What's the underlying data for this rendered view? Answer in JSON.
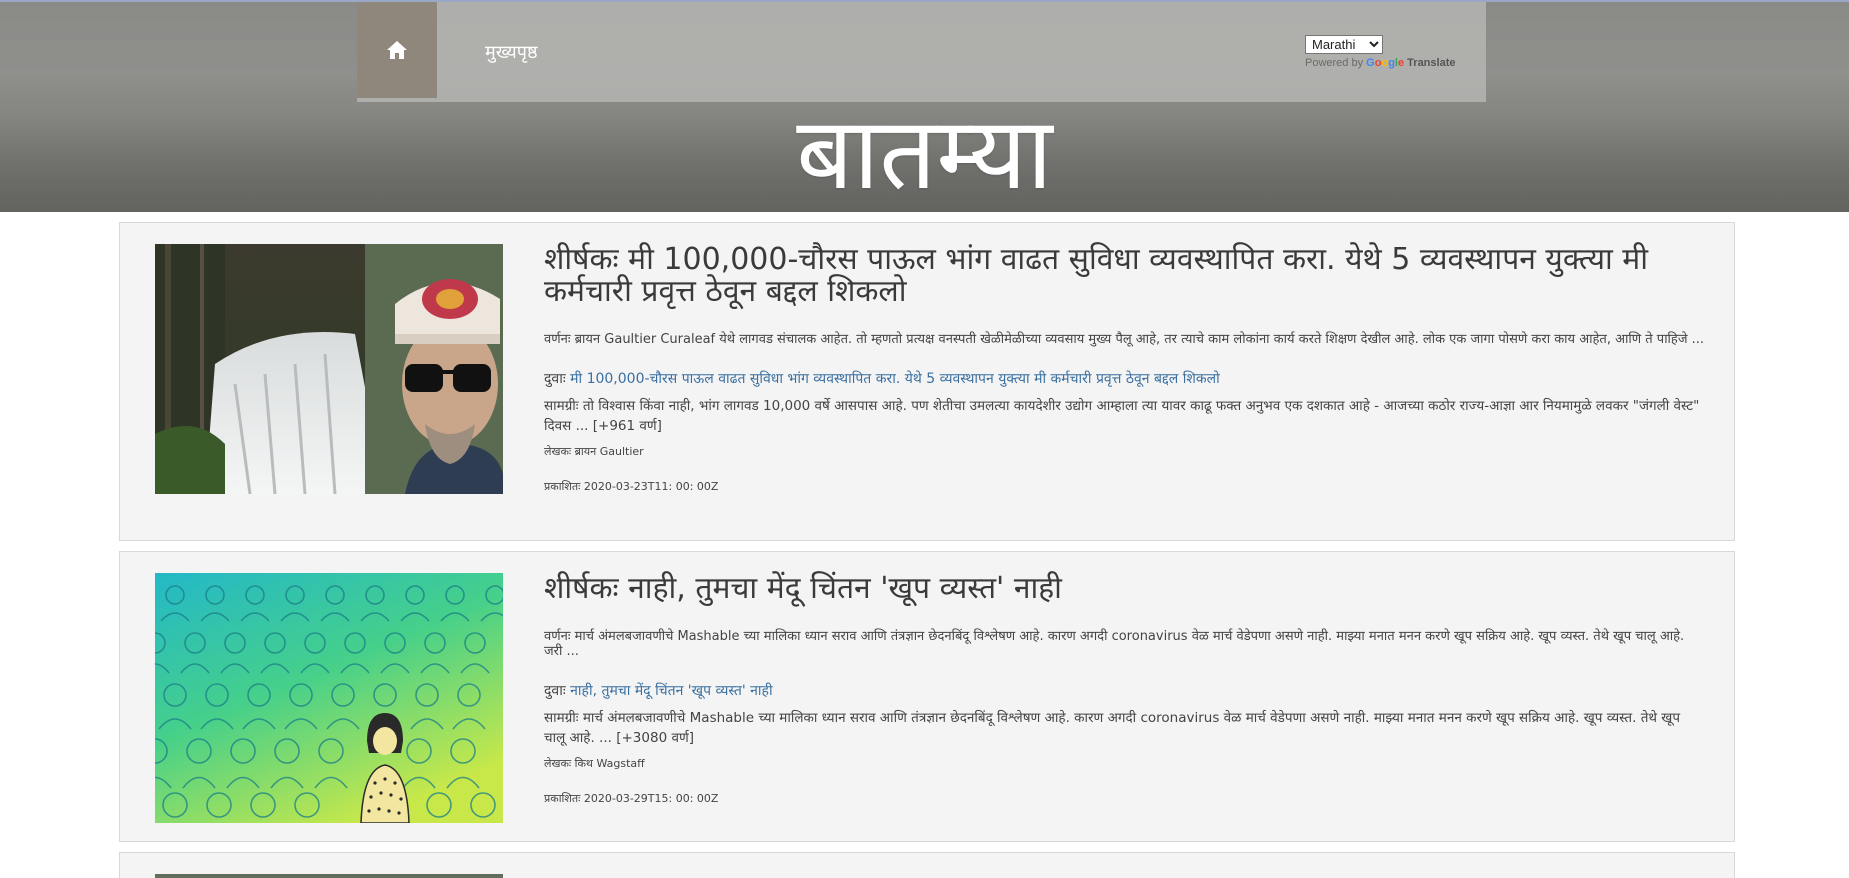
{
  "nav": {
    "home_label": "मुख्यपृष्ठ",
    "language_selected": "Marathi",
    "powered_by": "Powered by",
    "google_logo": "Google",
    "translate_label": "Translate"
  },
  "page": {
    "title": "बातम्या"
  },
  "articles": [
    {
      "title": "शीर्षकः मी 100,000-चौरस पाऊल भांग वाढत सुविधा व्यवस्थापित करा. येथे 5 व्यवस्थापन युक्त्या मी कर्मचारी प्रवृत्त ठेवून बद्दल शिकलो",
      "description": "वर्णनः ब्रायन Gaultier Curaleaf येथे लागवड संचालक आहेत. तो म्हणतो प्रत्यक्ष वनस्पती खेळीमेळीच्या व्यवसाय मुख्य पैलू आहे, तर त्याचे काम लोकांना कार्य करते शिक्षण देखील आहे. लोक एक जागा पोसणे करा काय आहेत, आणि ते पाहिजे ...",
      "link_prefix": "दुवाः",
      "link_text": "मी 100,000-चौरस पाऊल वाढत सुविधा भांग व्यवस्थापित करा. येथे 5 व्यवस्थापन युक्त्या मी कर्मचारी प्रवृत्त ठेवून बद्दल शिकलो",
      "content": "सामग्रीः तो विश्वास किंवा नाही, भांग लागवड 10,000 वर्षे आसपास आहे. पण शेतीचा उमलत्या कायदेशीर उद्योग आम्हाला त्या यावर काढू फक्त अनुभव एक दशकात आहे - आजच्या कठोर राज्य-आज्ञा आर नियमामुळे लवकर \"जंगली वेस्ट\" दिवस ... [+961 वर्ण]",
      "author": "लेखकः ब्रायन Gaultier",
      "published": "प्रकाशितः 2020-03-23T11: 00: 00Z"
    },
    {
      "title": "शीर्षकः नाही, तुमचा मेंदू चिंतन 'खूप व्यस्त' नाही",
      "description": "वर्णनः मार्च अंमलबजावणीचे Mashable च्या मालिका ध्यान सराव आणि तंत्रज्ञान छेदनबिंदू विश्लेषण आहे. कारण अगदी coronavirus वेळ मार्च वेडेपणा असणे नाही. माझ्या मनात मनन करणे खूप सक्रिय आहे. खूप व्यस्त. तेथे खूप चालू आहे. जरी ...",
      "link_prefix": "दुवाः",
      "link_text": "नाही, तुमचा मेंदू चिंतन 'खूप व्यस्त' नाही",
      "content": "सामग्रीः मार्च अंमलबजावणीचे Mashable च्या मालिका ध्यान सराव आणि तंत्रज्ञान छेदनबिंदू विश्लेषण आहे. कारण अगदी coronavirus वेळ मार्च वेडेपणा असणे नाही. माझ्या मनात मनन करणे खूप सक्रिय आहे. खूप व्यस्त. तेथे खूप चालू आहे. ... [+3080 वर्ण]",
      "author": "लेखकः किथ Wagstaff",
      "published": "प्रकाशितः 2020-03-29T15: 00: 00Z"
    }
  ],
  "icons": {
    "home": "home-icon"
  }
}
